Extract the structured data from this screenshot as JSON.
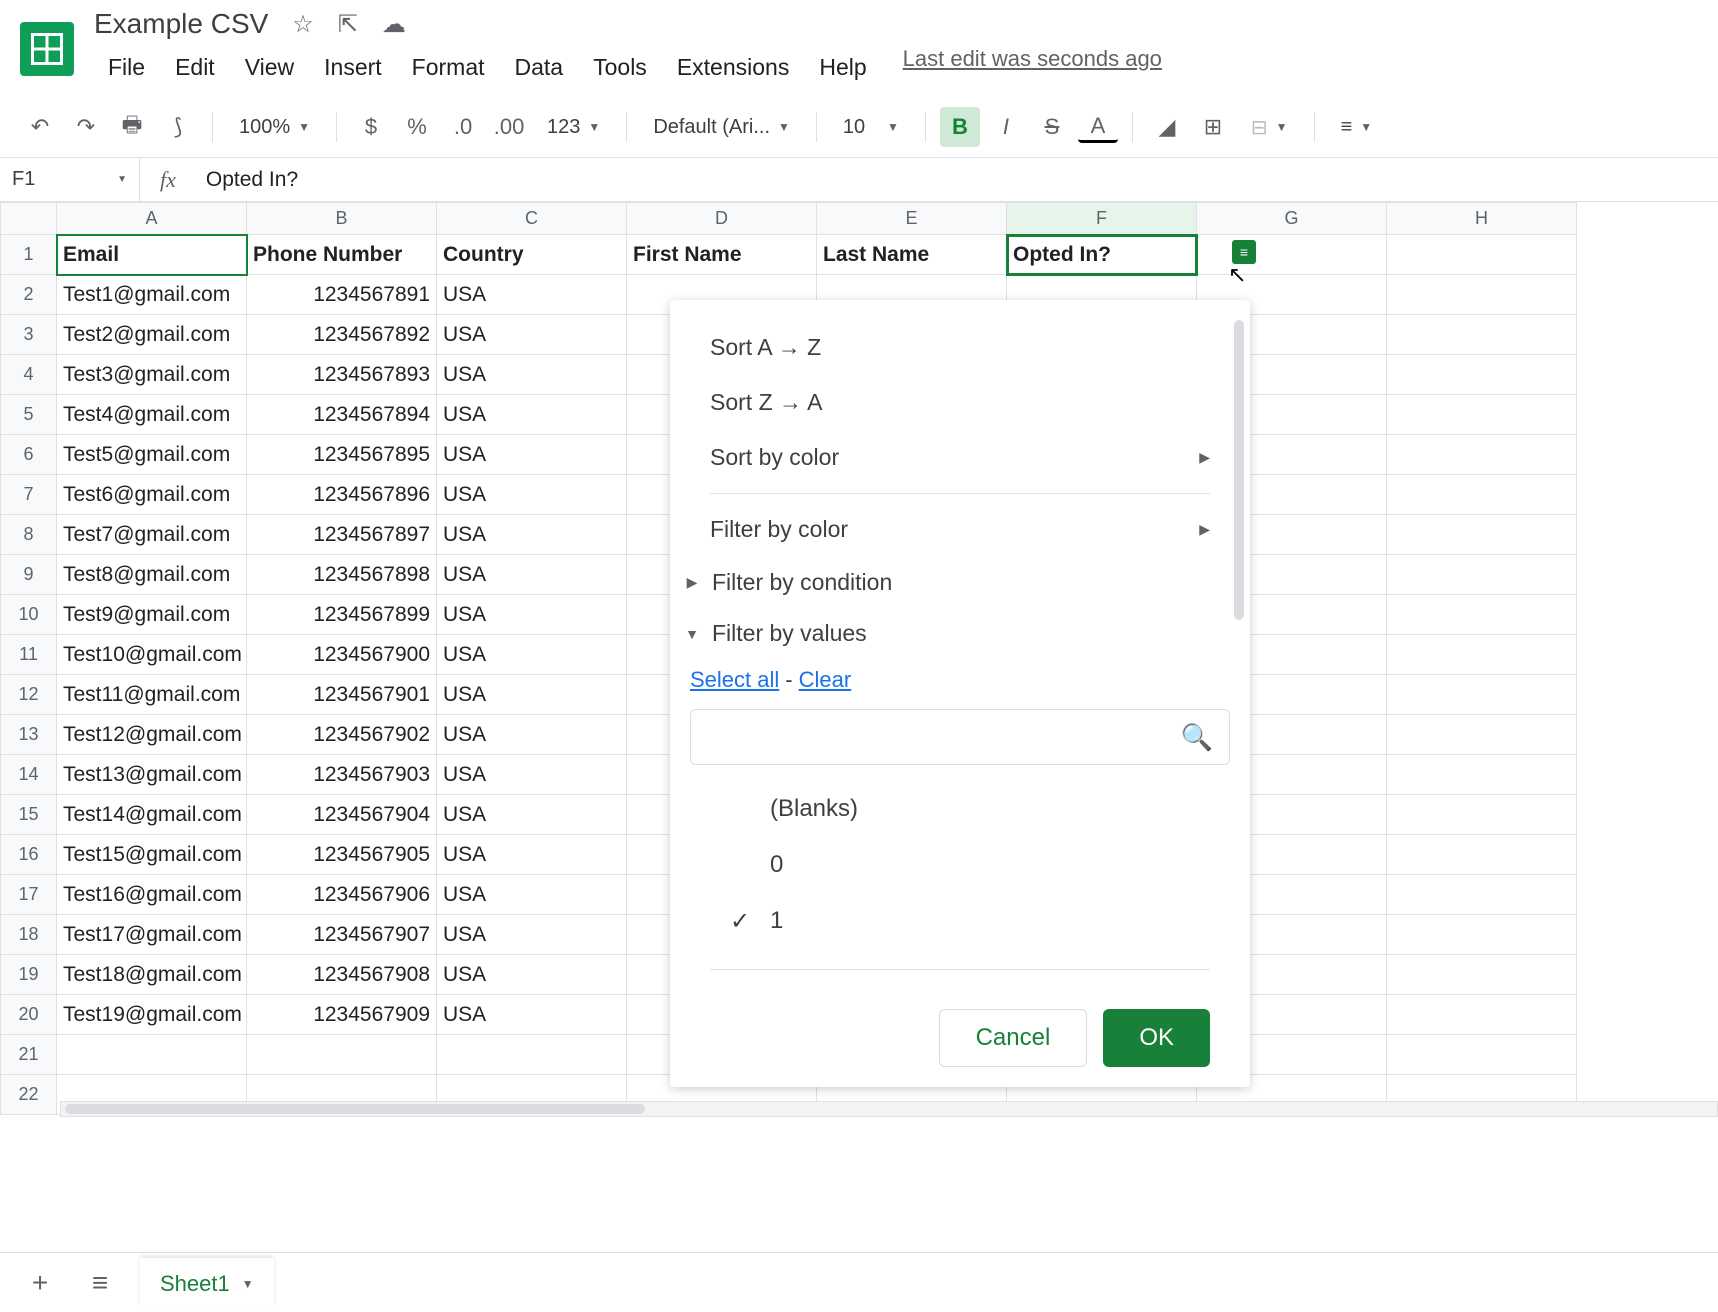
{
  "doc": {
    "title": "Example CSV"
  },
  "menus": [
    "File",
    "Edit",
    "View",
    "Insert",
    "Format",
    "Data",
    "Tools",
    "Extensions",
    "Help"
  ],
  "last_edit": "Last edit was seconds ago",
  "toolbar": {
    "zoom": "100%",
    "font": "Default (Ari...",
    "font_size": "10",
    "number_format": "123"
  },
  "name_box": "F1",
  "formula_value": "Opted In?",
  "columns": [
    "A",
    "B",
    "C",
    "D",
    "E",
    "F",
    "G",
    "H"
  ],
  "headers": [
    "Email",
    "Phone Number",
    "Country",
    "First Name",
    "Last Name",
    "Opted In?",
    "",
    ""
  ],
  "rows": [
    [
      "Test1@gmail.com",
      "1234567891",
      "USA"
    ],
    [
      "Test2@gmail.com",
      "1234567892",
      "USA"
    ],
    [
      "Test3@gmail.com",
      "1234567893",
      "USA"
    ],
    [
      "Test4@gmail.com",
      "1234567894",
      "USA"
    ],
    [
      "Test5@gmail.com",
      "1234567895",
      "USA"
    ],
    [
      "Test6@gmail.com",
      "1234567896",
      "USA"
    ],
    [
      "Test7@gmail.com",
      "1234567897",
      "USA"
    ],
    [
      "Test8@gmail.com",
      "1234567898",
      "USA"
    ],
    [
      "Test9@gmail.com",
      "1234567899",
      "USA"
    ],
    [
      "Test10@gmail.com",
      "1234567900",
      "USA"
    ],
    [
      "Test11@gmail.com",
      "1234567901",
      "USA"
    ],
    [
      "Test12@gmail.com",
      "1234567902",
      "USA"
    ],
    [
      "Test13@gmail.com",
      "1234567903",
      "USA"
    ],
    [
      "Test14@gmail.com",
      "1234567904",
      "USA"
    ],
    [
      "Test15@gmail.com",
      "1234567905",
      "USA"
    ],
    [
      "Test16@gmail.com",
      "1234567906",
      "USA"
    ],
    [
      "Test17@gmail.com",
      "1234567907",
      "USA"
    ],
    [
      "Test18@gmail.com",
      "1234567908",
      "USA"
    ],
    [
      "Test19@gmail.com",
      "1234567909",
      "USA"
    ]
  ],
  "row_count": 22,
  "filter": {
    "sort_az": "Sort A → Z",
    "sort_za": "Sort Z → A",
    "sort_color": "Sort by color",
    "filter_color": "Filter by color",
    "filter_condition": "Filter by condition",
    "filter_values": "Filter by values",
    "select_all": "Select all",
    "clear": "Clear",
    "values": [
      {
        "label": "(Blanks)",
        "checked": false
      },
      {
        "label": "0",
        "checked": false
      },
      {
        "label": "1",
        "checked": true
      }
    ],
    "cancel": "Cancel",
    "ok": "OK"
  },
  "sheet_tab": "Sheet1"
}
